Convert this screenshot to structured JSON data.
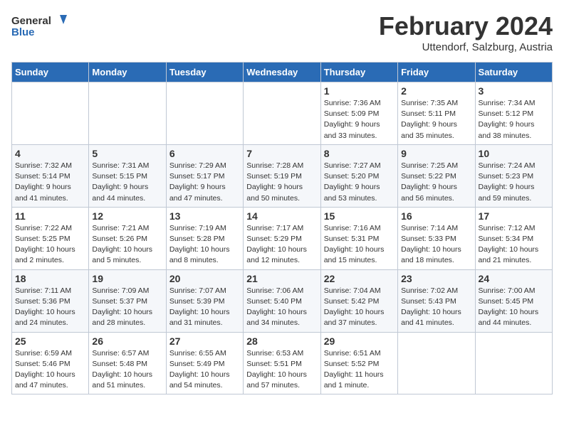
{
  "logo": {
    "general": "General",
    "blue": "Blue"
  },
  "title": "February 2024",
  "subtitle": "Uttendorf, Salzburg, Austria",
  "days_of_week": [
    "Sunday",
    "Monday",
    "Tuesday",
    "Wednesday",
    "Thursday",
    "Friday",
    "Saturday"
  ],
  "weeks": [
    [
      {
        "day": "",
        "info": ""
      },
      {
        "day": "",
        "info": ""
      },
      {
        "day": "",
        "info": ""
      },
      {
        "day": "",
        "info": ""
      },
      {
        "day": "1",
        "info": "Sunrise: 7:36 AM\nSunset: 5:09 PM\nDaylight: 9 hours\nand 33 minutes."
      },
      {
        "day": "2",
        "info": "Sunrise: 7:35 AM\nSunset: 5:11 PM\nDaylight: 9 hours\nand 35 minutes."
      },
      {
        "day": "3",
        "info": "Sunrise: 7:34 AM\nSunset: 5:12 PM\nDaylight: 9 hours\nand 38 minutes."
      }
    ],
    [
      {
        "day": "4",
        "info": "Sunrise: 7:32 AM\nSunset: 5:14 PM\nDaylight: 9 hours\nand 41 minutes."
      },
      {
        "day": "5",
        "info": "Sunrise: 7:31 AM\nSunset: 5:15 PM\nDaylight: 9 hours\nand 44 minutes."
      },
      {
        "day": "6",
        "info": "Sunrise: 7:29 AM\nSunset: 5:17 PM\nDaylight: 9 hours\nand 47 minutes."
      },
      {
        "day": "7",
        "info": "Sunrise: 7:28 AM\nSunset: 5:19 PM\nDaylight: 9 hours\nand 50 minutes."
      },
      {
        "day": "8",
        "info": "Sunrise: 7:27 AM\nSunset: 5:20 PM\nDaylight: 9 hours\nand 53 minutes."
      },
      {
        "day": "9",
        "info": "Sunrise: 7:25 AM\nSunset: 5:22 PM\nDaylight: 9 hours\nand 56 minutes."
      },
      {
        "day": "10",
        "info": "Sunrise: 7:24 AM\nSunset: 5:23 PM\nDaylight: 9 hours\nand 59 minutes."
      }
    ],
    [
      {
        "day": "11",
        "info": "Sunrise: 7:22 AM\nSunset: 5:25 PM\nDaylight: 10 hours\nand 2 minutes."
      },
      {
        "day": "12",
        "info": "Sunrise: 7:21 AM\nSunset: 5:26 PM\nDaylight: 10 hours\nand 5 minutes."
      },
      {
        "day": "13",
        "info": "Sunrise: 7:19 AM\nSunset: 5:28 PM\nDaylight: 10 hours\nand 8 minutes."
      },
      {
        "day": "14",
        "info": "Sunrise: 7:17 AM\nSunset: 5:29 PM\nDaylight: 10 hours\nand 12 minutes."
      },
      {
        "day": "15",
        "info": "Sunrise: 7:16 AM\nSunset: 5:31 PM\nDaylight: 10 hours\nand 15 minutes."
      },
      {
        "day": "16",
        "info": "Sunrise: 7:14 AM\nSunset: 5:33 PM\nDaylight: 10 hours\nand 18 minutes."
      },
      {
        "day": "17",
        "info": "Sunrise: 7:12 AM\nSunset: 5:34 PM\nDaylight: 10 hours\nand 21 minutes."
      }
    ],
    [
      {
        "day": "18",
        "info": "Sunrise: 7:11 AM\nSunset: 5:36 PM\nDaylight: 10 hours\nand 24 minutes."
      },
      {
        "day": "19",
        "info": "Sunrise: 7:09 AM\nSunset: 5:37 PM\nDaylight: 10 hours\nand 28 minutes."
      },
      {
        "day": "20",
        "info": "Sunrise: 7:07 AM\nSunset: 5:39 PM\nDaylight: 10 hours\nand 31 minutes."
      },
      {
        "day": "21",
        "info": "Sunrise: 7:06 AM\nSunset: 5:40 PM\nDaylight: 10 hours\nand 34 minutes."
      },
      {
        "day": "22",
        "info": "Sunrise: 7:04 AM\nSunset: 5:42 PM\nDaylight: 10 hours\nand 37 minutes."
      },
      {
        "day": "23",
        "info": "Sunrise: 7:02 AM\nSunset: 5:43 PM\nDaylight: 10 hours\nand 41 minutes."
      },
      {
        "day": "24",
        "info": "Sunrise: 7:00 AM\nSunset: 5:45 PM\nDaylight: 10 hours\nand 44 minutes."
      }
    ],
    [
      {
        "day": "25",
        "info": "Sunrise: 6:59 AM\nSunset: 5:46 PM\nDaylight: 10 hours\nand 47 minutes."
      },
      {
        "day": "26",
        "info": "Sunrise: 6:57 AM\nSunset: 5:48 PM\nDaylight: 10 hours\nand 51 minutes."
      },
      {
        "day": "27",
        "info": "Sunrise: 6:55 AM\nSunset: 5:49 PM\nDaylight: 10 hours\nand 54 minutes."
      },
      {
        "day": "28",
        "info": "Sunrise: 6:53 AM\nSunset: 5:51 PM\nDaylight: 10 hours\nand 57 minutes."
      },
      {
        "day": "29",
        "info": "Sunrise: 6:51 AM\nSunset: 5:52 PM\nDaylight: 11 hours\nand 1 minute."
      },
      {
        "day": "",
        "info": ""
      },
      {
        "day": "",
        "info": ""
      }
    ]
  ]
}
